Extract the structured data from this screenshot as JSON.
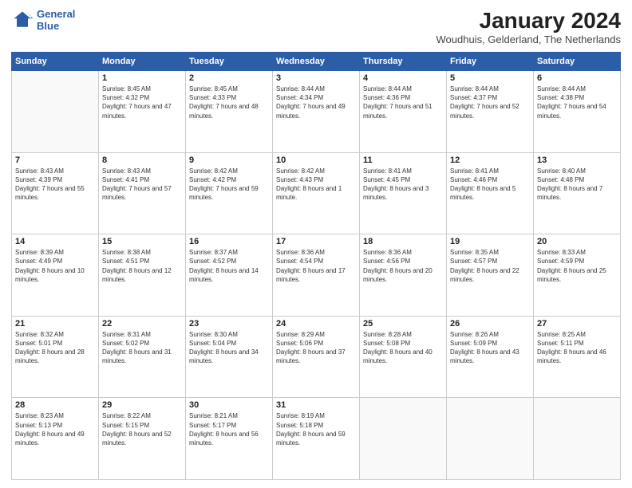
{
  "logo": {
    "line1": "General",
    "line2": "Blue"
  },
  "title": "January 2024",
  "subtitle": "Woudhuis, Gelderland, The Netherlands",
  "weekdays": [
    "Sunday",
    "Monday",
    "Tuesday",
    "Wednesday",
    "Thursday",
    "Friday",
    "Saturday"
  ],
  "weeks": [
    [
      {
        "day": "",
        "sunrise": "",
        "sunset": "",
        "daylight": ""
      },
      {
        "day": "1",
        "sunrise": "Sunrise: 8:45 AM",
        "sunset": "Sunset: 4:32 PM",
        "daylight": "Daylight: 7 hours and 47 minutes."
      },
      {
        "day": "2",
        "sunrise": "Sunrise: 8:45 AM",
        "sunset": "Sunset: 4:33 PM",
        "daylight": "Daylight: 7 hours and 48 minutes."
      },
      {
        "day": "3",
        "sunrise": "Sunrise: 8:44 AM",
        "sunset": "Sunset: 4:34 PM",
        "daylight": "Daylight: 7 hours and 49 minutes."
      },
      {
        "day": "4",
        "sunrise": "Sunrise: 8:44 AM",
        "sunset": "Sunset: 4:36 PM",
        "daylight": "Daylight: 7 hours and 51 minutes."
      },
      {
        "day": "5",
        "sunrise": "Sunrise: 8:44 AM",
        "sunset": "Sunset: 4:37 PM",
        "daylight": "Daylight: 7 hours and 52 minutes."
      },
      {
        "day": "6",
        "sunrise": "Sunrise: 8:44 AM",
        "sunset": "Sunset: 4:38 PM",
        "daylight": "Daylight: 7 hours and 54 minutes."
      }
    ],
    [
      {
        "day": "7",
        "sunrise": "Sunrise: 8:43 AM",
        "sunset": "Sunset: 4:39 PM",
        "daylight": "Daylight: 7 hours and 55 minutes."
      },
      {
        "day": "8",
        "sunrise": "Sunrise: 8:43 AM",
        "sunset": "Sunset: 4:41 PM",
        "daylight": "Daylight: 7 hours and 57 minutes."
      },
      {
        "day": "9",
        "sunrise": "Sunrise: 8:42 AM",
        "sunset": "Sunset: 4:42 PM",
        "daylight": "Daylight: 7 hours and 59 minutes."
      },
      {
        "day": "10",
        "sunrise": "Sunrise: 8:42 AM",
        "sunset": "Sunset: 4:43 PM",
        "daylight": "Daylight: 8 hours and 1 minute."
      },
      {
        "day": "11",
        "sunrise": "Sunrise: 8:41 AM",
        "sunset": "Sunset: 4:45 PM",
        "daylight": "Daylight: 8 hours and 3 minutes."
      },
      {
        "day": "12",
        "sunrise": "Sunrise: 8:41 AM",
        "sunset": "Sunset: 4:46 PM",
        "daylight": "Daylight: 8 hours and 5 minutes."
      },
      {
        "day": "13",
        "sunrise": "Sunrise: 8:40 AM",
        "sunset": "Sunset: 4:48 PM",
        "daylight": "Daylight: 8 hours and 7 minutes."
      }
    ],
    [
      {
        "day": "14",
        "sunrise": "Sunrise: 8:39 AM",
        "sunset": "Sunset: 4:49 PM",
        "daylight": "Daylight: 8 hours and 10 minutes."
      },
      {
        "day": "15",
        "sunrise": "Sunrise: 8:38 AM",
        "sunset": "Sunset: 4:51 PM",
        "daylight": "Daylight: 8 hours and 12 minutes."
      },
      {
        "day": "16",
        "sunrise": "Sunrise: 8:37 AM",
        "sunset": "Sunset: 4:52 PM",
        "daylight": "Daylight: 8 hours and 14 minutes."
      },
      {
        "day": "17",
        "sunrise": "Sunrise: 8:36 AM",
        "sunset": "Sunset: 4:54 PM",
        "daylight": "Daylight: 8 hours and 17 minutes."
      },
      {
        "day": "18",
        "sunrise": "Sunrise: 8:36 AM",
        "sunset": "Sunset: 4:56 PM",
        "daylight": "Daylight: 8 hours and 20 minutes."
      },
      {
        "day": "19",
        "sunrise": "Sunrise: 8:35 AM",
        "sunset": "Sunset: 4:57 PM",
        "daylight": "Daylight: 8 hours and 22 minutes."
      },
      {
        "day": "20",
        "sunrise": "Sunrise: 8:33 AM",
        "sunset": "Sunset: 4:59 PM",
        "daylight": "Daylight: 8 hours and 25 minutes."
      }
    ],
    [
      {
        "day": "21",
        "sunrise": "Sunrise: 8:32 AM",
        "sunset": "Sunset: 5:01 PM",
        "daylight": "Daylight: 8 hours and 28 minutes."
      },
      {
        "day": "22",
        "sunrise": "Sunrise: 8:31 AM",
        "sunset": "Sunset: 5:02 PM",
        "daylight": "Daylight: 8 hours and 31 minutes."
      },
      {
        "day": "23",
        "sunrise": "Sunrise: 8:30 AM",
        "sunset": "Sunset: 5:04 PM",
        "daylight": "Daylight: 8 hours and 34 minutes."
      },
      {
        "day": "24",
        "sunrise": "Sunrise: 8:29 AM",
        "sunset": "Sunset: 5:06 PM",
        "daylight": "Daylight: 8 hours and 37 minutes."
      },
      {
        "day": "25",
        "sunrise": "Sunrise: 8:28 AM",
        "sunset": "Sunset: 5:08 PM",
        "daylight": "Daylight: 8 hours and 40 minutes."
      },
      {
        "day": "26",
        "sunrise": "Sunrise: 8:26 AM",
        "sunset": "Sunset: 5:09 PM",
        "daylight": "Daylight: 8 hours and 43 minutes."
      },
      {
        "day": "27",
        "sunrise": "Sunrise: 8:25 AM",
        "sunset": "Sunset: 5:11 PM",
        "daylight": "Daylight: 8 hours and 46 minutes."
      }
    ],
    [
      {
        "day": "28",
        "sunrise": "Sunrise: 8:23 AM",
        "sunset": "Sunset: 5:13 PM",
        "daylight": "Daylight: 8 hours and 49 minutes."
      },
      {
        "day": "29",
        "sunrise": "Sunrise: 8:22 AM",
        "sunset": "Sunset: 5:15 PM",
        "daylight": "Daylight: 8 hours and 52 minutes."
      },
      {
        "day": "30",
        "sunrise": "Sunrise: 8:21 AM",
        "sunset": "Sunset: 5:17 PM",
        "daylight": "Daylight: 8 hours and 56 minutes."
      },
      {
        "day": "31",
        "sunrise": "Sunrise: 8:19 AM",
        "sunset": "Sunset: 5:18 PM",
        "daylight": "Daylight: 8 hours and 59 minutes."
      },
      {
        "day": "",
        "sunrise": "",
        "sunset": "",
        "daylight": ""
      },
      {
        "day": "",
        "sunrise": "",
        "sunset": "",
        "daylight": ""
      },
      {
        "day": "",
        "sunrise": "",
        "sunset": "",
        "daylight": ""
      }
    ]
  ]
}
